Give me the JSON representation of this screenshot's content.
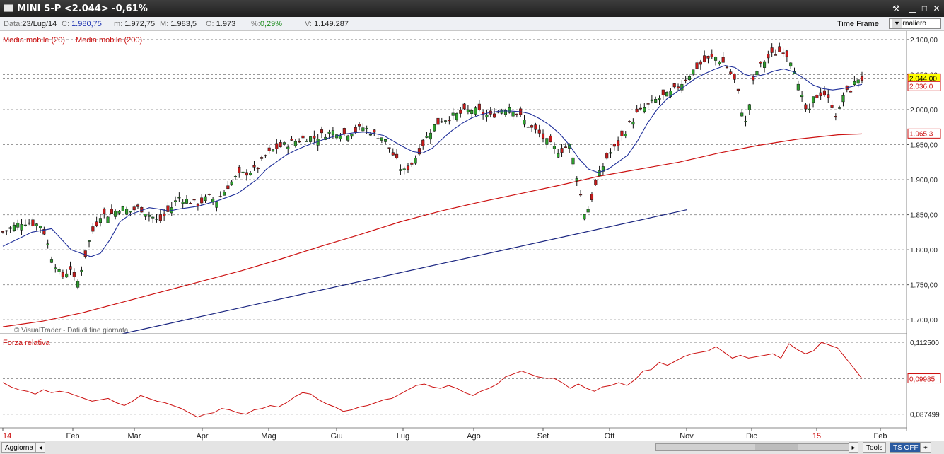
{
  "window": {
    "title": "MINI S-P <2.044> -0,61%"
  },
  "toolbar": {
    "data_label": "Data:",
    "data_value": "23/Lug/14",
    "c_label": "C:",
    "c_value": "1.980,75",
    "m_label": "m:",
    "m_value": "1.972,75",
    "M_label": "M:",
    "M_value": "1.983,5",
    "o_label": "O:",
    "o_value": "1.973",
    "pct_label": "%:",
    "pct_value": "0,29%",
    "v_label": "V:",
    "v_value": "1.149.287",
    "time_frame_label": "Time Frame",
    "time_frame_value": "Giornaliero"
  },
  "buttons": {
    "aggiorna": "Aggiorna",
    "tools": "Tools",
    "ts_off": "TS OFF",
    "plus": "+",
    "scroll_arrow": "▸"
  },
  "chart_data": [
    {
      "type": "candlestick",
      "legend": [
        "Media mobile (20)",
        "Media mobile (200)"
      ],
      "watermark": "© VisualTrader - Dati di fine giornata",
      "ylim": [
        1680,
        2110
      ],
      "yticks": [
        "1.700,00",
        "1.750,00",
        "1.800,00",
        "1.850,00",
        "1.900,00",
        "1.950,00",
        "2.000,00",
        "2.050,00",
        "2.100,00"
      ],
      "ytick_values": [
        1700,
        1750,
        1800,
        1850,
        1900,
        1950,
        2000,
        2050,
        2100
      ],
      "price_labels": [
        {
          "text": "2.044,00",
          "value": 2044,
          "color": "#ffff00"
        },
        {
          "text": "2.036,0",
          "value": 2036,
          "color": "#ffffff"
        },
        {
          "text": "1.965,3",
          "value": 1965.3,
          "color": "#ffffff"
        }
      ],
      "xticks": [
        "14",
        "Feb",
        "Mar",
        "Apr",
        "Mag",
        "Giu",
        "Lug",
        "Ago",
        "Set",
        "Ott",
        "Nov",
        "Dic",
        "15",
        "Feb"
      ],
      "series_close": [
        [
          0,
          1825
        ],
        [
          2,
          1840
        ],
        [
          4,
          1835
        ],
        [
          5,
          1790
        ],
        [
          6,
          1760
        ],
        [
          7,
          1775
        ],
        [
          7.5,
          1745
        ],
        [
          8,
          1770
        ],
        [
          8.6,
          1800
        ],
        [
          9,
          1820
        ],
        [
          10,
          1850
        ],
        [
          11,
          1850
        ],
        [
          12,
          1860
        ],
        [
          13,
          1855
        ],
        [
          14,
          1860
        ],
        [
          15,
          1850
        ],
        [
          16,
          1840
        ],
        [
          17,
          1855
        ],
        [
          18,
          1875
        ],
        [
          19,
          1870
        ],
        [
          20,
          1865
        ],
        [
          21,
          1875
        ],
        [
          22,
          1870
        ],
        [
          23,
          1890
        ],
        [
          24,
          1905
        ],
        [
          25,
          1910
        ],
        [
          26,
          1915
        ],
        [
          27,
          1935
        ],
        [
          28,
          1945
        ],
        [
          29,
          1950
        ],
        [
          30,
          1955
        ],
        [
          31,
          1960
        ],
        [
          32,
          1960
        ],
        [
          33,
          1965
        ],
        [
          34,
          1970
        ],
        [
          35,
          1965
        ],
        [
          36,
          1970
        ],
        [
          37,
          1975
        ],
        [
          38,
          1965
        ],
        [
          39,
          1960
        ],
        [
          40,
          1935
        ],
        [
          41,
          1910
        ],
        [
          42,
          1925
        ],
        [
          43,
          1950
        ],
        [
          44,
          1975
        ],
        [
          45,
          1985
        ],
        [
          46,
          1990
        ],
        [
          47,
          1995
        ],
        [
          48,
          2000
        ],
        [
          49,
          1995
        ],
        [
          50,
          1990
        ],
        [
          51,
          2000
        ],
        [
          52,
          2005
        ],
        [
          53,
          1990
        ],
        [
          54,
          1975
        ],
        [
          55,
          1965
        ],
        [
          56,
          1950
        ],
        [
          57,
          1940
        ],
        [
          58,
          1950
        ],
        [
          58.6,
          1920
        ],
        [
          59,
          1890
        ],
        [
          59.6,
          1850
        ],
        [
          60,
          1860
        ],
        [
          60.6,
          1885
        ],
        [
          61,
          1905
        ],
        [
          62,
          1935
        ],
        [
          63,
          1950
        ],
        [
          64,
          1975
        ],
        [
          65,
          1995
        ],
        [
          66,
          2005
        ],
        [
          67,
          2015
        ],
        [
          68,
          2020
        ],
        [
          69,
          2030
        ],
        [
          70,
          2045
        ],
        [
          71,
          2060
        ],
        [
          72,
          2070
        ],
        [
          73,
          2075
        ],
        [
          74,
          2065
        ],
        [
          75,
          2040
        ],
        [
          75.5,
          2015
        ],
        [
          76,
          1975
        ],
        [
          76.5,
          2010
        ],
        [
          77,
          2050
        ],
        [
          78,
          2070
        ],
        [
          79,
          2080
        ],
        [
          80,
          2085
        ],
        [
          81,
          2065
        ],
        [
          81.5,
          2030
        ],
        [
          82,
          2010
        ],
        [
          82.5,
          1990
        ],
        [
          83,
          2015
        ],
        [
          84,
          2025
        ],
        [
          85,
          2005
        ],
        [
          85.5,
          1985
        ],
        [
          86,
          2020
        ],
        [
          87,
          2030
        ],
        [
          87.5,
          2045
        ],
        [
          88,
          2044
        ]
      ],
      "ma20": [
        [
          0,
          1805
        ],
        [
          3,
          1825
        ],
        [
          5,
          1830
        ],
        [
          6,
          1815
        ],
        [
          7,
          1800
        ],
        [
          8,
          1795
        ],
        [
          9,
          1790
        ],
        [
          10,
          1795
        ],
        [
          11,
          1815
        ],
        [
          12,
          1840
        ],
        [
          13,
          1850
        ],
        [
          14,
          1855
        ],
        [
          15,
          1860
        ],
        [
          16,
          1858
        ],
        [
          17,
          1855
        ],
        [
          18,
          1858
        ],
        [
          19,
          1860
        ],
        [
          20,
          1862
        ],
        [
          21,
          1866
        ],
        [
          22,
          1870
        ],
        [
          23,
          1875
        ],
        [
          24,
          1880
        ],
        [
          25,
          1890
        ],
        [
          26,
          1900
        ],
        [
          27,
          1915
        ],
        [
          28,
          1925
        ],
        [
          29,
          1935
        ],
        [
          30,
          1942
        ],
        [
          31,
          1948
        ],
        [
          32,
          1953
        ],
        [
          33,
          1958
        ],
        [
          34,
          1962
        ],
        [
          35,
          1965
        ],
        [
          36,
          1967
        ],
        [
          37,
          1968
        ],
        [
          38,
          1966
        ],
        [
          39,
          1963
        ],
        [
          40,
          1955
        ],
        [
          41,
          1947
        ],
        [
          42,
          1940
        ],
        [
          43,
          1938
        ],
        [
          44,
          1945
        ],
        [
          45,
          1958
        ],
        [
          46,
          1970
        ],
        [
          47,
          1980
        ],
        [
          48,
          1988
        ],
        [
          49,
          1993
        ],
        [
          50,
          1996
        ],
        [
          51,
          1998
        ],
        [
          52,
          1998
        ],
        [
          53,
          1997
        ],
        [
          54,
          1994
        ],
        [
          55,
          1987
        ],
        [
          56,
          1978
        ],
        [
          57,
          1966
        ],
        [
          58,
          1950
        ],
        [
          59,
          1930
        ],
        [
          60,
          1915
        ],
        [
          61,
          1910
        ],
        [
          62,
          1915
        ],
        [
          63,
          1925
        ],
        [
          64,
          1935
        ],
        [
          65,
          1955
        ],
        [
          66,
          1980
        ],
        [
          67,
          2000
        ],
        [
          68,
          2015
        ],
        [
          69,
          2025
        ],
        [
          70,
          2035
        ],
        [
          71,
          2045
        ],
        [
          72,
          2052
        ],
        [
          73,
          2058
        ],
        [
          74,
          2063
        ],
        [
          75,
          2060
        ],
        [
          76,
          2050
        ],
        [
          77,
          2047
        ],
        [
          78,
          2050
        ],
        [
          79,
          2055
        ],
        [
          80,
          2058
        ],
        [
          81,
          2054
        ],
        [
          82,
          2045
        ],
        [
          83,
          2035
        ],
        [
          84,
          2030
        ],
        [
          85,
          2028
        ],
        [
          86,
          2030
        ],
        [
          87,
          2033
        ],
        [
          88,
          2036
        ]
      ],
      "ma200": [
        [
          0,
          1690
        ],
        [
          5,
          1698
        ],
        [
          10,
          1710
        ],
        [
          15,
          1725
        ],
        [
          20,
          1740
        ],
        [
          25,
          1755
        ],
        [
          30,
          1770
        ],
        [
          35,
          1787
        ],
        [
          40,
          1805
        ],
        [
          45,
          1822
        ],
        [
          50,
          1840
        ],
        [
          55,
          1855
        ],
        [
          60,
          1868
        ],
        [
          65,
          1880
        ],
        [
          70,
          1892
        ],
        [
          75,
          1905
        ],
        [
          80,
          1915
        ],
        [
          85,
          1925
        ],
        [
          90,
          1938
        ],
        [
          95,
          1949
        ],
        [
          100,
          1958
        ],
        [
          105,
          1964
        ],
        [
          108,
          1965.3
        ]
      ],
      "trendline": [
        [
          15,
          1680
        ],
        [
          86,
          1857
        ]
      ]
    },
    {
      "type": "line",
      "title": "Forza relativa",
      "yticks": [
        "0,112500",
        "0,087499"
      ],
      "ytick_values": [
        0.1125,
        0.087499
      ],
      "ylim": [
        0.0835,
        0.1135
      ],
      "price_label": {
        "text": "0,09985",
        "value": 0.09985
      },
      "series": [
        {
          "name": "Forza relativa",
          "values": [
            0.0985,
            0.097,
            0.096,
            0.0955,
            0.0945,
            0.096,
            0.095,
            0.0955,
            0.095,
            0.094,
            0.093,
            0.092,
            0.0925,
            0.093,
            0.0915,
            0.0905,
            0.092,
            0.094,
            0.093,
            0.092,
            0.0915,
            0.0905,
            0.0895,
            0.088,
            0.0865,
            0.0875,
            0.088,
            0.0895,
            0.089,
            0.088,
            0.0875,
            0.089,
            0.0895,
            0.0905,
            0.09,
            0.0915,
            0.0935,
            0.095,
            0.0945,
            0.0925,
            0.091,
            0.09,
            0.0885,
            0.089,
            0.09,
            0.0905,
            0.0915,
            0.0925,
            0.093,
            0.0945,
            0.096,
            0.0975,
            0.098,
            0.097,
            0.0965,
            0.0975,
            0.0965,
            0.095,
            0.094,
            0.0955,
            0.0965,
            0.098,
            0.1005,
            0.1015,
            0.1025,
            0.1015,
            0.1005,
            0.1,
            0.1,
            0.0985,
            0.0965,
            0.098,
            0.0965,
            0.0955,
            0.097,
            0.0975,
            0.0985,
            0.0975,
            0.0995,
            0.1025,
            0.103,
            0.1055,
            0.1045,
            0.106,
            0.1075,
            0.1085,
            0.109,
            0.1095,
            0.111,
            0.109,
            0.107,
            0.108,
            0.107,
            0.1075,
            0.108,
            0.1085,
            0.107,
            0.112,
            0.11,
            0.1085,
            0.1095,
            0.1125,
            0.1115,
            0.1105,
            0.107,
            0.1035,
            0.0999
          ]
        }
      ]
    }
  ]
}
